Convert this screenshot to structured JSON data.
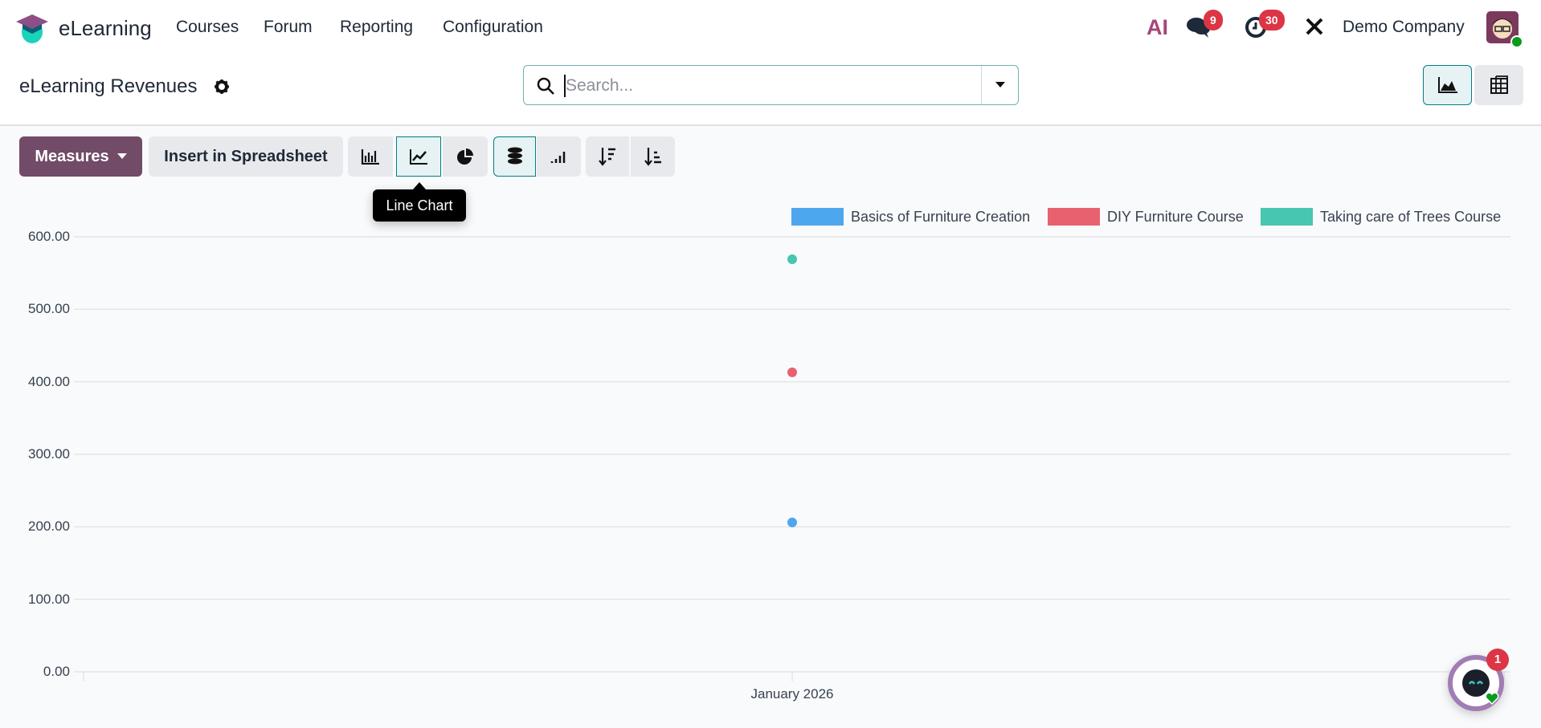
{
  "navbar": {
    "app_name": "eLearning",
    "menu": [
      "Courses",
      "Forum",
      "Reporting",
      "Configuration"
    ],
    "ai_label": "AI",
    "messages_count": "9",
    "activities_count": "30",
    "company": "Demo Company"
  },
  "control_panel": {
    "title": "eLearning Revenues",
    "search_placeholder": "Search..."
  },
  "toolbar": {
    "measures": "Measures",
    "insert": "Insert in Spreadsheet",
    "tooltip": "Line Chart"
  },
  "chat": {
    "badge": "1"
  },
  "chart_data": {
    "type": "line",
    "title": "",
    "xlabel": "",
    "ylabel": "",
    "categories": [
      "January 2026"
    ],
    "yticks": [
      "0.00",
      "100.00",
      "200.00",
      "300.00",
      "400.00",
      "500.00",
      "600.00"
    ],
    "ylim": [
      0,
      600
    ],
    "grid": true,
    "legend": "top-right",
    "series": [
      {
        "name": "Basics of Furniture Creation",
        "color": "#4ea6ef",
        "values": [
          206
        ]
      },
      {
        "name": "DIY Furniture Course",
        "color": "#e8616f",
        "values": [
          413
        ]
      },
      {
        "name": "Taking care of Trees Course",
        "color": "#47c6b1",
        "values": [
          569
        ]
      }
    ]
  }
}
